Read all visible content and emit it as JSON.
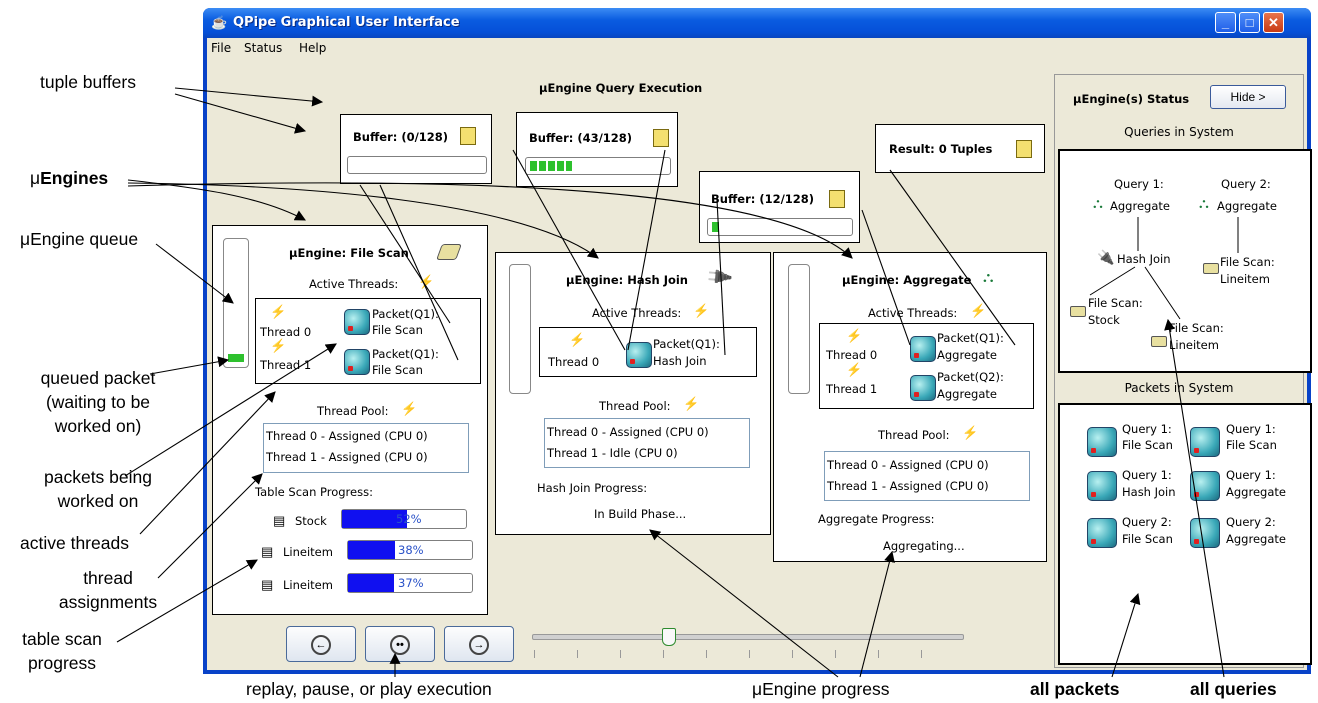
{
  "window": {
    "title": "QPipe Graphical User Interface",
    "menu": [
      "File",
      "Status",
      "Help"
    ]
  },
  "main": {
    "heading": "μEngine Query Execution",
    "buffers": [
      {
        "label": "Buffer: (0/128)",
        "fill": 0
      },
      {
        "label": "Buffer: (43/128)",
        "fill": 0.336
      },
      {
        "label": "Buffer: (12/128)",
        "fill": 0.094
      }
    ],
    "result_label": "Result: 0 Tuples",
    "engines": {
      "file_scan": {
        "title": "μEngine: File Scan",
        "active_threads_label": "Active Threads:",
        "threads": [
          {
            "thread": "Thread 0",
            "packet_line1": "Packet(Q1):",
            "packet_line2": "File Scan"
          },
          {
            "thread": "Thread 1",
            "packet_line1": "Packet(Q1):",
            "packet_line2": "File Scan"
          }
        ],
        "thread_pool_label": "Thread Pool:",
        "pool": [
          "Thread 0 - Assigned (CPU 0)",
          "Thread 1 - Assigned (CPU 0)"
        ],
        "progress_label": "Table Scan Progress:",
        "scans": [
          {
            "table": "Stock",
            "percent_text": "52%",
            "fraction": 0.52
          },
          {
            "table": "Lineitem",
            "percent_text": "38%",
            "fraction": 0.38
          },
          {
            "table": "Lineitem",
            "percent_text": "37%",
            "fraction": 0.37
          }
        ]
      },
      "hash_join": {
        "title": "μEngine: Hash Join",
        "active_threads_label": "Active Threads:",
        "threads": [
          {
            "thread": "Thread 0",
            "packet_line1": "Packet(Q1):",
            "packet_line2": "Hash Join"
          }
        ],
        "thread_pool_label": "Thread Pool:",
        "pool": [
          "Thread 0 - Assigned (CPU 0)",
          "Thread 1 - Idle (CPU 0)"
        ],
        "progress_label": "Hash Join Progress:",
        "progress_value": "In Build Phase..."
      },
      "aggregate": {
        "title": "μEngine: Aggregate",
        "active_threads_label": "Active Threads:",
        "threads": [
          {
            "thread": "Thread 0",
            "packet_line1": "Packet(Q1):",
            "packet_line2": "Aggregate"
          },
          {
            "thread": "Thread 1",
            "packet_line1": "Packet(Q2):",
            "packet_line2": "Aggregate"
          }
        ],
        "thread_pool_label": "Thread Pool:",
        "pool": [
          "Thread 0 - Assigned (CPU 0)",
          "Thread 1 - Assigned (CPU 0)"
        ],
        "progress_label": "Aggregate Progress:",
        "progress_value": "Aggregating..."
      }
    },
    "slider_position": 0.3
  },
  "status_panel": {
    "title": "μEngine(s) Status",
    "hide_button": "Hide >",
    "queries_header": "Queries in System",
    "query1": "Query 1:",
    "query2": "Query 2:",
    "agg1": "Aggregate",
    "agg2": "Aggregate",
    "hash_join": "Hash Join",
    "fs_stock_1": "File Scan:",
    "fs_stock_2": "Stock",
    "fs_line_a1": "File Scan:",
    "fs_line_a2": "Lineitem",
    "fs_line_b1": "File Scan:",
    "fs_line_b2": "Lineitem",
    "packets_header": "Packets in System",
    "packets": [
      {
        "l1": "Query 1:",
        "l2": "File Scan"
      },
      {
        "l1": "Query 1:",
        "l2": "File Scan"
      },
      {
        "l1": "Query 1:",
        "l2": "Hash Join"
      },
      {
        "l1": "Query 1:",
        "l2": "Aggregate"
      },
      {
        "l1": "Query 2:",
        "l2": "File Scan"
      },
      {
        "l1": "Query 2:",
        "l2": "Aggregate"
      }
    ]
  },
  "annotations": {
    "tuple_buffers": "tuple buffers",
    "uengines_mu": "μ",
    "uengines_word": "Engines",
    "uengine_queue": "μEngine queue",
    "queued_packet_1": "queued packet",
    "queued_packet_2": "(waiting to be",
    "queued_packet_3": "worked on)",
    "packets_worked_1": "packets being",
    "packets_worked_2": "worked on",
    "active_threads": "active threads",
    "thread_assign_1": "thread",
    "thread_assign_2": "assignments",
    "table_scan_1": "table scan",
    "table_scan_2": "progress",
    "replay": "replay, pause, or play execution",
    "uengine_progress": "μEngine progress",
    "all_packets": "all packets",
    "all_queries": "all queries"
  }
}
